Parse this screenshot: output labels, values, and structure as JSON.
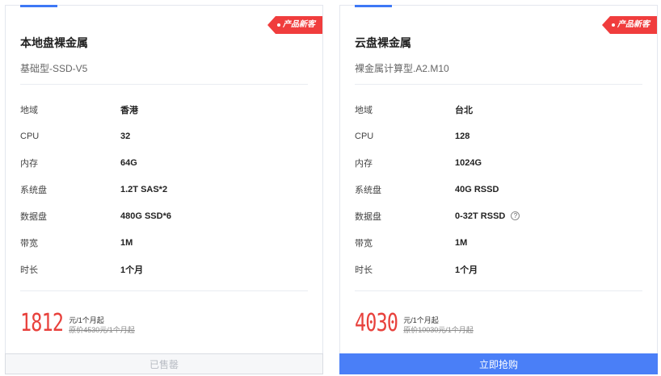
{
  "cards": [
    {
      "tag": "产品新客",
      "title": "本地盘裸金属",
      "subtitle": "基础型-SSD-V5",
      "specs": [
        {
          "label": "地域",
          "value": "香港"
        },
        {
          "label": "CPU",
          "value": "32"
        },
        {
          "label": "内存",
          "value": "64G"
        },
        {
          "label": "系统盘",
          "value": "1.2T SAS*2"
        },
        {
          "label": "数据盘",
          "value": "480G SSD*6"
        },
        {
          "label": "带宽",
          "value": "1M"
        },
        {
          "label": "时长",
          "value": "1个月"
        }
      ],
      "price": "1812",
      "price_unit": "元/1个月起",
      "original_price": "原价4530元/1个月起",
      "button_label": "已售罄"
    },
    {
      "tag": "产品新客",
      "title": "云盘裸金属",
      "subtitle": "裸金属计算型.A2.M10",
      "specs": [
        {
          "label": "地域",
          "value": "台北"
        },
        {
          "label": "CPU",
          "value": "128"
        },
        {
          "label": "内存",
          "value": "1024G"
        },
        {
          "label": "系统盘",
          "value": "40G RSSD"
        },
        {
          "label": "数据盘",
          "value": "0-32T RSSD",
          "help_icon": "question-circle-icon"
        },
        {
          "label": "带宽",
          "value": "1M"
        },
        {
          "label": "时长",
          "value": "1个月"
        }
      ],
      "price": "4030",
      "price_unit": "元/1个月起",
      "original_price": "原价10030元/1个月起",
      "button_label": "立即抢购"
    }
  ],
  "colors": {
    "accent": "#3d78f5",
    "price": "#e8413c",
    "tag": "#f03d3d",
    "buy_button": "#4a7ff7"
  }
}
